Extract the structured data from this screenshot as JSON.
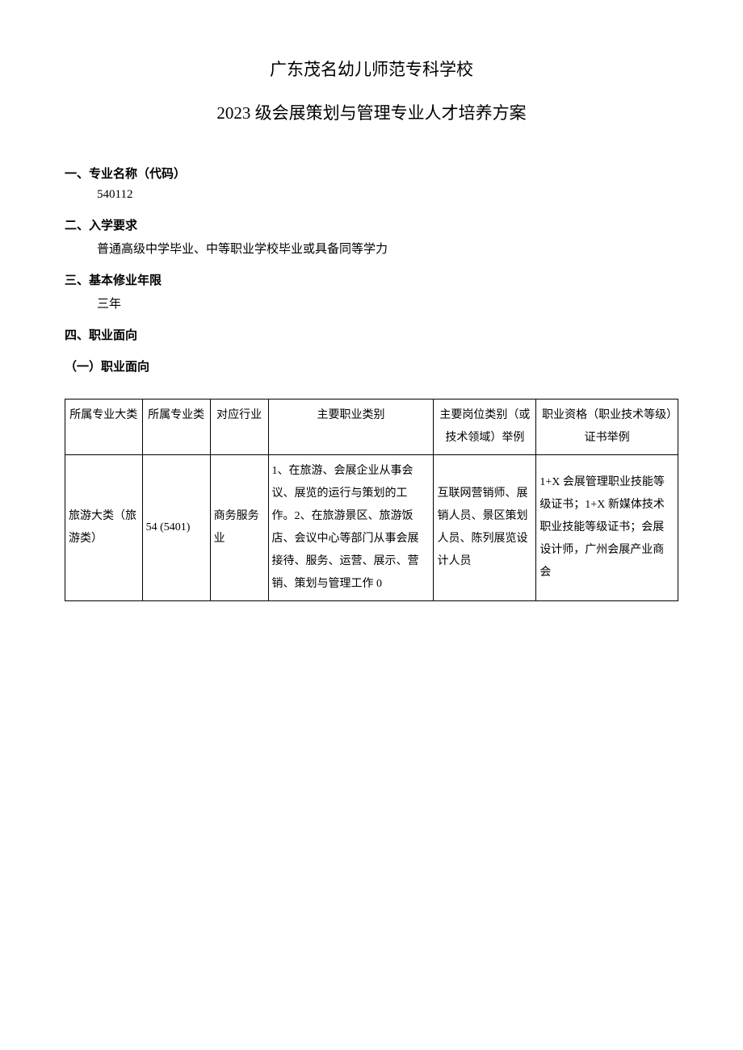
{
  "header": {
    "school": "广东茂名幼儿师范专科学校",
    "doc_title": "2023 级会展策划与管理专业人才培养方案"
  },
  "sections": {
    "s1_heading": "一、专业名称（代码）",
    "s1_body": "540112",
    "s2_heading": "二、入学要求",
    "s2_body": "普通高级中学毕业、中等职业学校毕业或具备同等学力",
    "s3_heading": "三、基本修业年限",
    "s3_body": "三年",
    "s4_heading": "四、职业面向",
    "s4_sub": "（一）职业面向"
  },
  "table": {
    "headers": {
      "c1": "所属专业大类",
      "c2": "所属专业类",
      "c3": "对应行业",
      "c4": "主要职业类别",
      "c5": "主要岗位类别（或技术领域）举例",
      "c6": "职业资格（职业技术等级）证书举例"
    },
    "row": {
      "c1": "旅游大类（旅游类）",
      "c2": "54 (5401)",
      "c3": "商务服务业",
      "c4": "1、在旅游、会展企业从事会议、展览的运行与策划的工作。2、在旅游景区、旅游饭店、会议中心等部门从事会展接待、服务、运营、展示、营销、策划与管理工作 0",
      "c5": "互联网营销师、展销人员、景区策划人员、陈列展览设计人员",
      "c6": "1+X 会展管理职业技能等级证书；1+X 新媒体技术职业技能等级证书；会展设计师，广州会展产业商会"
    }
  }
}
